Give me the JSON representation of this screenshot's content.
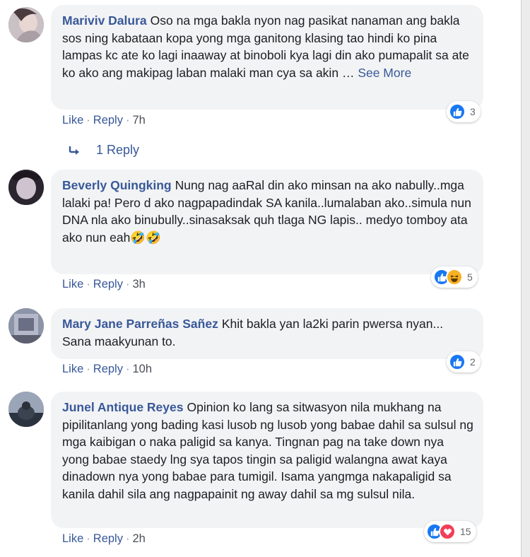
{
  "comments": [
    {
      "author": "Mariviv Dalura",
      "text": "Oso na mga bakla nyon nag pasikat nanaman ang bakla sos ning kabataan kopa yong mga ganitong klasing tao hindi ko pina lampas kc ate ko lagi inaaway at binoboli kya lagi din ako pumapalit sa ate ko ako ang makipag laban malaki man cya sa akin",
      "ellipsis": "…",
      "see_more": "See More",
      "like": "Like",
      "reply": "Reply",
      "time": "7h",
      "reaction_count": "3",
      "reactions": [
        "like-icon"
      ]
    },
    {
      "author": "Beverly Quingking",
      "text": "Nung nag aaRal din ako minsan na ako nabully..mga lalaki pa! Pero d ako nagpapadindak SA kanila..lumalaban ako..simula nun DNA nla ako binubully..sinasaksak quh tlaga NG lapis.. medyo tomboy ata ako nun eah",
      "emoji": "🤣🤣",
      "like": "Like",
      "reply": "Reply",
      "time": "3h",
      "reaction_count": "5",
      "reactions": [
        "like-icon",
        "haha-icon"
      ]
    },
    {
      "author": "Mary Jane Parreñas Sañez",
      "text": "Khit bakla yan la2ki parin pwersa nyan... Sana maakyunan to.",
      "like": "Like",
      "reply": "Reply",
      "time": "10h",
      "reaction_count": "2",
      "reactions": [
        "like-icon"
      ]
    },
    {
      "author": "Junel Antique Reyes",
      "text": "Opinion ko lang sa sitwasyon nila mukhang na pipilitanlang yong bading kasi lusob ng lusob yong babae dahil sa sulsul ng mga kaibigan o naka paligid sa kanya. Tingnan pag na take down nya yong babae staedy lng sya tapos tingin sa paligid walangna awat kaya dinadown nya yong babae para tumigil. Isama yangmga nakapaligid sa kanila dahil sila ang nagpapainit ng away dahil sa mg sulsul nila.",
      "like": "Like",
      "reply": "Reply",
      "time": "2h",
      "reaction_count": "15",
      "reactions": [
        "like-icon",
        "love-icon"
      ]
    }
  ],
  "replies_link": "1 Reply",
  "colors": {
    "link": "#385898",
    "bubble": "#f2f3f5",
    "like": "#1877f2",
    "haha": "#f7b125",
    "love": "#f33e58"
  }
}
